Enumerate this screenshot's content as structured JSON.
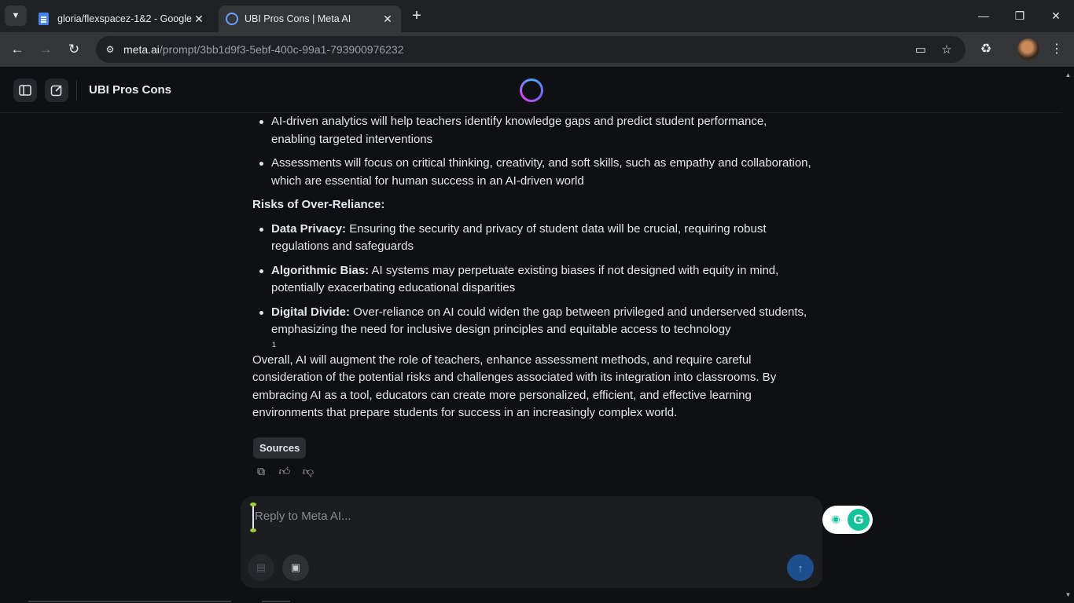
{
  "browser": {
    "tabs": [
      {
        "title": "gloria/flexspacez-1&2 - Google",
        "favicon": "google-docs-icon",
        "active": false
      },
      {
        "title": "UBI Pros Cons | Meta AI",
        "favicon": "meta-ai-icon",
        "active": true
      }
    ],
    "url": {
      "host": "meta.ai",
      "path": "/prompt/3bb1d9f3-5ebf-400c-99a1-793900976232"
    }
  },
  "header": {
    "title": "UBI Pros Cons"
  },
  "content": {
    "bullets_top": [
      "AI-driven analytics will help teachers identify knowledge gaps and predict student performance, enabling targeted interventions",
      "Assessments will focus on critical thinking, creativity, and soft skills, such as empathy and collaboration, which are essential for human success in an AI-driven world"
    ],
    "section_heading": "Risks of Over-Reliance:",
    "risks": [
      {
        "label": "Data Privacy:",
        "text": " Ensuring the security and privacy of student data will be crucial, requiring robust regulations and safeguards"
      },
      {
        "label": "Algorithmic Bias:",
        "text": " AI systems may perpetuate existing biases if not designed with equity in mind, potentially exacerbating educational disparities"
      },
      {
        "label": "Digital Divide:",
        "text": " Over-reliance on AI could widen the gap between privileged and underserved students, emphasizing the need for inclusive design principles and equitable access to technology"
      }
    ],
    "footnote": "1",
    "conclusion": "Overall, AI will augment the role of teachers, enhance assessment methods, and require careful consideration of the potential risks and challenges associated with its integration into classrooms. By embracing AI as a tool, educators can create more personalized, efficient, and effective learning environments that prepare students for success in an increasingly complex world.",
    "sources_label": "Sources"
  },
  "composer": {
    "placeholder": "Reply to Meta AI..."
  },
  "grammarly": {
    "logo": "G"
  }
}
